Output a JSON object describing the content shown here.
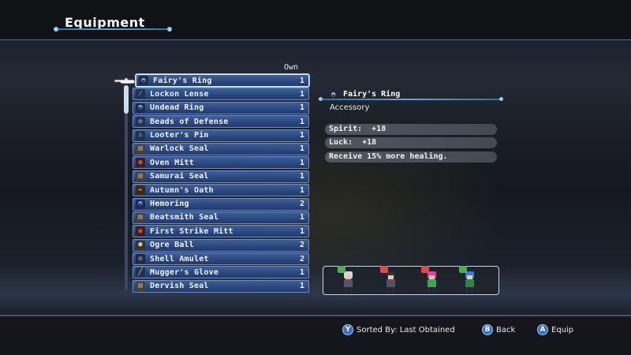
{
  "header": {
    "title": "Equipment"
  },
  "list": {
    "own_header": "Own",
    "items": [
      {
        "name": "Fairy's Ring",
        "count": "1",
        "icon": "ring-icon",
        "selected": true
      },
      {
        "name": "Lockon Lense",
        "count": "1",
        "icon": "lens-icon"
      },
      {
        "name": "Undead Ring",
        "count": "1",
        "icon": "ring-icon"
      },
      {
        "name": "Beads of Defense",
        "count": "1",
        "icon": "beads-icon"
      },
      {
        "name": "Looter's Pin",
        "count": "1",
        "icon": "pin-icon"
      },
      {
        "name": "Warlock Seal",
        "count": "1",
        "icon": "seal-icon"
      },
      {
        "name": "Oven Mitt",
        "count": "1",
        "icon": "mitt-icon"
      },
      {
        "name": "Samurai Seal",
        "count": "1",
        "icon": "seal-icon"
      },
      {
        "name": "Autumn's Oath",
        "count": "1",
        "icon": "leaf-icon"
      },
      {
        "name": "Hemoring",
        "count": "2",
        "icon": "ring-icon"
      },
      {
        "name": "Beatsmith Seal",
        "count": "1",
        "icon": "seal-icon"
      },
      {
        "name": "First Strike Mitt",
        "count": "1",
        "icon": "mitt-icon"
      },
      {
        "name": "Ogre Ball",
        "count": "2",
        "icon": "ball-icon"
      },
      {
        "name": "Shell Amulet",
        "count": "2",
        "icon": "amulet-icon"
      },
      {
        "name": "Mugger's Glove",
        "count": "1",
        "icon": "glove-icon"
      },
      {
        "name": "Dervish Seal",
        "count": "1",
        "icon": "seal-icon"
      }
    ]
  },
  "detail": {
    "name": "Fairy's Ring",
    "type": "Accessory",
    "stats": [
      "Spirit:  +18",
      "Luck:  +18",
      "Receive 15% more healing."
    ]
  },
  "party": {
    "members": [
      {
        "badge": "up",
        "badge_color": "#4caf50",
        "hair": "#d8d8d8",
        "body": "#505868"
      },
      {
        "badge": "down",
        "badge_color": "#e04a4a",
        "hair": "#303038",
        "body": "#585060"
      },
      {
        "badge": "down",
        "badge_color": "#e04a4a",
        "hair": "#e040a0",
        "body": "#40a060"
      },
      {
        "badge": "up",
        "badge_color": "#4caf50",
        "hair": "#3a7ad8",
        "body": "#308050"
      }
    ]
  },
  "footer": {
    "sort": {
      "key": "Y",
      "label": "Sorted By: Last Obtained"
    },
    "back": {
      "key": "B",
      "label": "Back"
    },
    "equip": {
      "key": "A",
      "label": "Equip"
    }
  },
  "colors": {
    "accent": "#62a4d6",
    "item_bg": "#2c4880",
    "item_border": "#6f8ec8"
  }
}
